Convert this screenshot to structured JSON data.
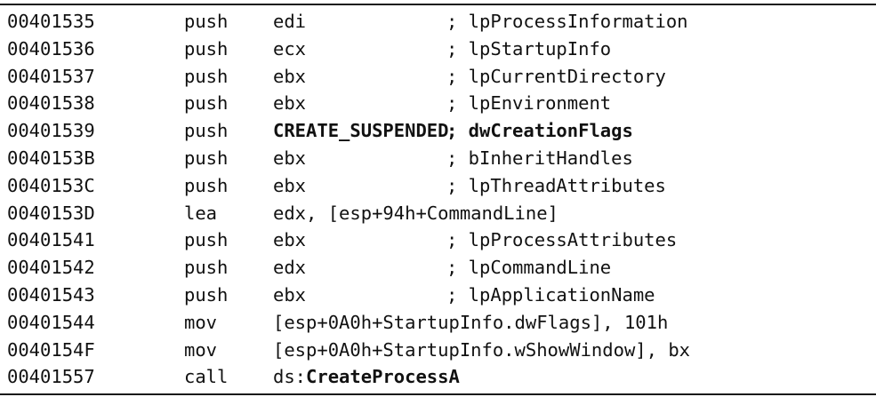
{
  "rows": [
    {
      "address": "00401535",
      "mnemonic": "push",
      "operand": "edi",
      "comment": "; lpProcessInformation"
    },
    {
      "address": "00401536",
      "mnemonic": "push",
      "operand": "ecx",
      "comment": "; lpStartupInfo"
    },
    {
      "address": "00401537",
      "mnemonic": "push",
      "operand": "ebx",
      "comment": "; lpCurrentDirectory"
    },
    {
      "address": "00401538",
      "mnemonic": "push",
      "operand": "ebx",
      "comment": "; lpEnvironment"
    },
    {
      "address": "00401539",
      "mnemonic": "push",
      "operand": "CREATE_SUSPENDED",
      "comment": "; dwCreationFlags"
    },
    {
      "address": "0040153B",
      "mnemonic": "push",
      "operand": "ebx",
      "comment": "; bInheritHandles"
    },
    {
      "address": "0040153C",
      "mnemonic": "push",
      "operand": "ebx",
      "comment": "; lpThreadAttributes"
    },
    {
      "address": "0040153D",
      "mnemonic": "lea",
      "operand": "edx, [esp+94h+CommandLine]",
      "comment": ""
    },
    {
      "address": "00401541",
      "mnemonic": "push",
      "operand": "ebx",
      "comment": "; lpProcessAttributes"
    },
    {
      "address": "00401542",
      "mnemonic": "push",
      "operand": "edx",
      "comment": "; lpCommandLine"
    },
    {
      "address": "00401543",
      "mnemonic": "push",
      "operand": "ebx",
      "comment": "; lpApplicationName"
    },
    {
      "address": "00401544",
      "mnemonic": "mov",
      "operand": "[esp+0A0h+StartupInfo.dwFlags], 101h",
      "comment": ""
    },
    {
      "address": "0040154F",
      "mnemonic": "mov",
      "operand": "[esp+0A0h+StartupInfo.wShowWindow], bx",
      "comment": ""
    },
    {
      "address": "00401557",
      "mnemonic": "call",
      "operand_prefix": "ds:",
      "operand_target": "CreateProcessA",
      "comment": ""
    }
  ]
}
